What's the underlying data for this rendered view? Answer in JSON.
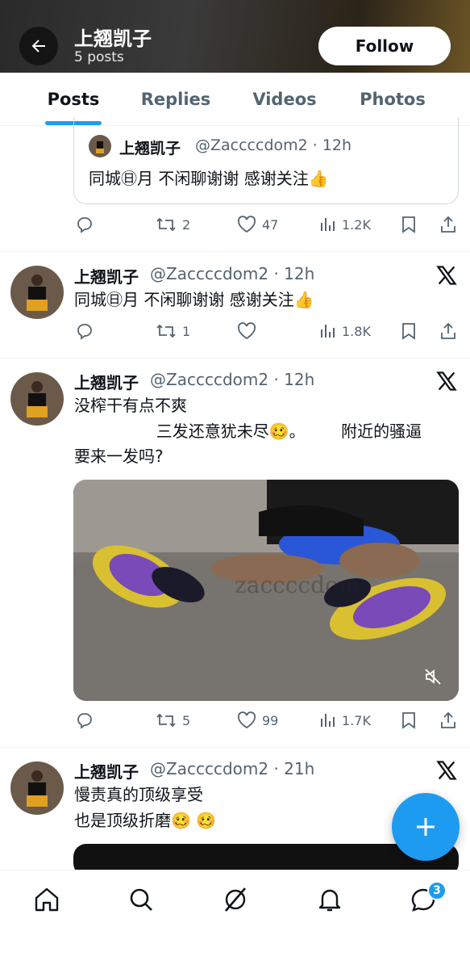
{
  "header": {
    "profile_name": "上翘凯子",
    "post_count": "5 posts",
    "follow_label": "Follow"
  },
  "tabs": [
    {
      "label": "Posts",
      "active": true
    },
    {
      "label": "Replies",
      "active": false
    },
    {
      "label": "Videos",
      "active": false
    },
    {
      "label": "Photos",
      "active": false
    }
  ],
  "quote": {
    "name": "上翘凯子",
    "handle": "@Zaccccdom2 · 12h",
    "text": "同城㊐月 不闲聊谢谢 感谢关注👍",
    "actions": {
      "reply": "",
      "retweet": "2",
      "like": "47",
      "views": "1.2K"
    }
  },
  "posts": [
    {
      "name": "上翘凯子",
      "handle": "@Zaccccdom2 · 12h",
      "text": "同城㊐月 不闲聊谢谢 感谢关注👍",
      "actions": {
        "reply": "",
        "retweet": "1",
        "like": "",
        "views": "1.8K"
      }
    },
    {
      "name": "上翘凯子",
      "handle": "@Zaccccdom2 · 12h",
      "text_lines": [
        "没榨干有点不爽",
        "                三发还意犹未尽🥴。       附近的骚逼",
        "要来一发吗?"
      ],
      "media_watermark": "zaccccdom",
      "actions": {
        "reply": "",
        "retweet": "5",
        "like": "99",
        "views": "1.7K"
      }
    },
    {
      "name": "上翘凯子",
      "handle": "@Zaccccdom2 · 21h",
      "text_lines": [
        "慢责真的顶级享受",
        "也是顶级折磨🥴 🥴"
      ]
    }
  ],
  "nav": {
    "items": [
      "home-icon",
      "search-icon",
      "grok-icon",
      "notifications-icon",
      "messages-icon"
    ],
    "messages_badge": "3"
  },
  "colors": {
    "accent": "#1d9bf0",
    "text": "#0f1419",
    "muted": "#536471"
  }
}
